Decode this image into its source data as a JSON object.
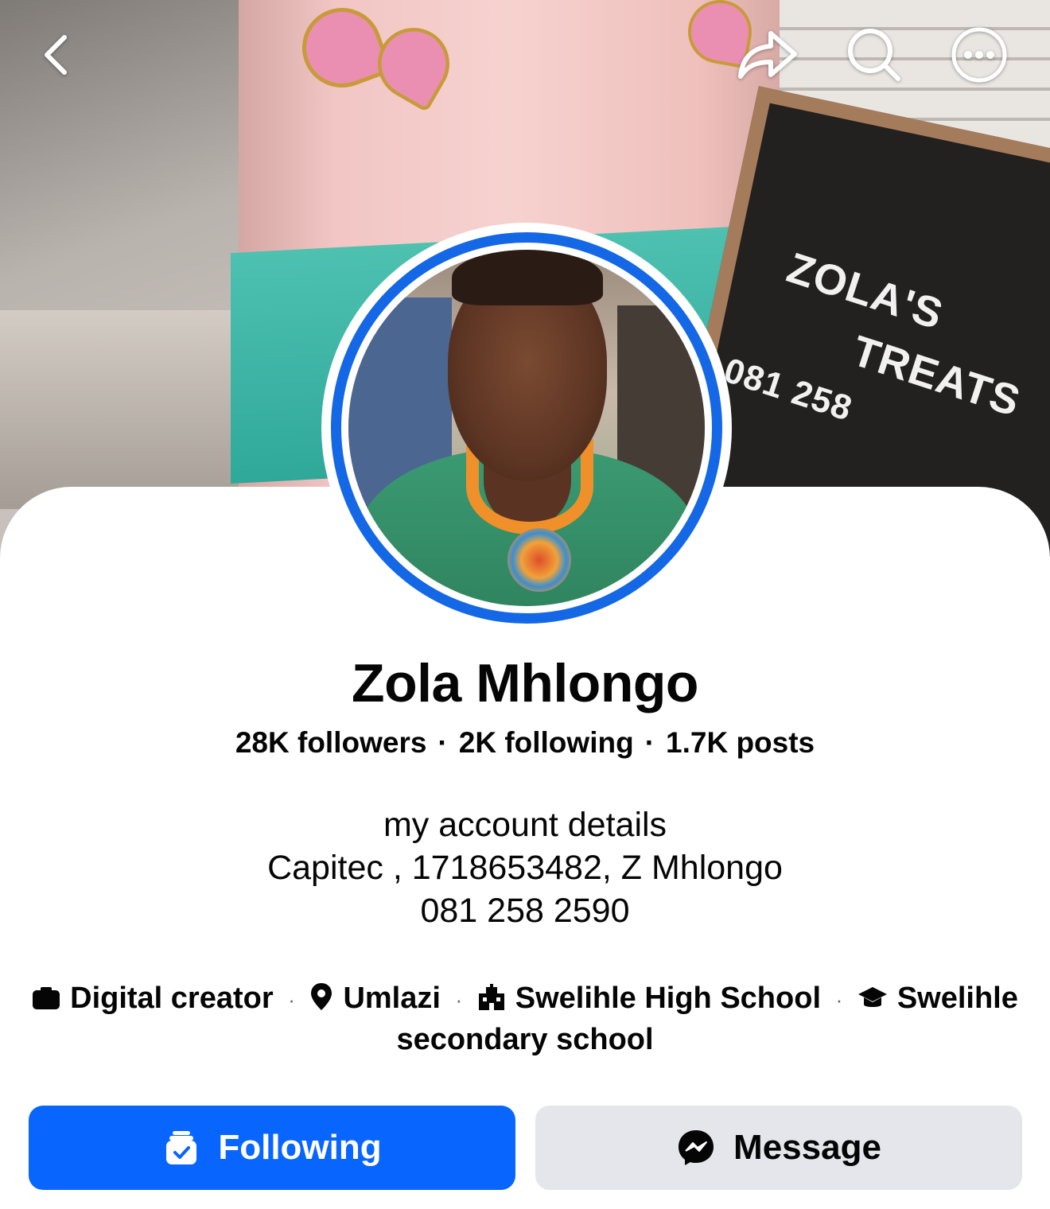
{
  "cover": {
    "board_lines": [
      "ZOLA'S",
      "TREATS",
      "081 258"
    ]
  },
  "topbar": {
    "back_icon": "chevron-left-icon",
    "share_icon": "share-arrow-icon",
    "search_icon": "search-icon",
    "more_icon": "more-dots-icon"
  },
  "profile": {
    "name": "Zola Mhlongo",
    "followers": "28K followers",
    "following": "2K following",
    "posts": "1.7K posts",
    "separator": "·",
    "bio": [
      "my account details",
      "Capitec , 1718653482, Z Mhlongo",
      "081 258 2590"
    ]
  },
  "details": {
    "items": [
      {
        "icon": "briefcase-icon",
        "label": "Digital creator"
      },
      {
        "icon": "location-pin-icon",
        "label": "Umlazi"
      },
      {
        "icon": "school-building-icon",
        "label": "Swelihle High School"
      },
      {
        "icon": "graduation-cap-icon",
        "label": "Swelihle secondary school"
      }
    ],
    "separator": "·"
  },
  "actions": {
    "following_label": "Following",
    "message_label": "Message",
    "following_icon": "following-check-icon",
    "message_icon": "messenger-icon"
  },
  "colors": {
    "accent": "#0866ff",
    "ring": "#1467e5",
    "secondary_button": "#e4e6eb"
  }
}
